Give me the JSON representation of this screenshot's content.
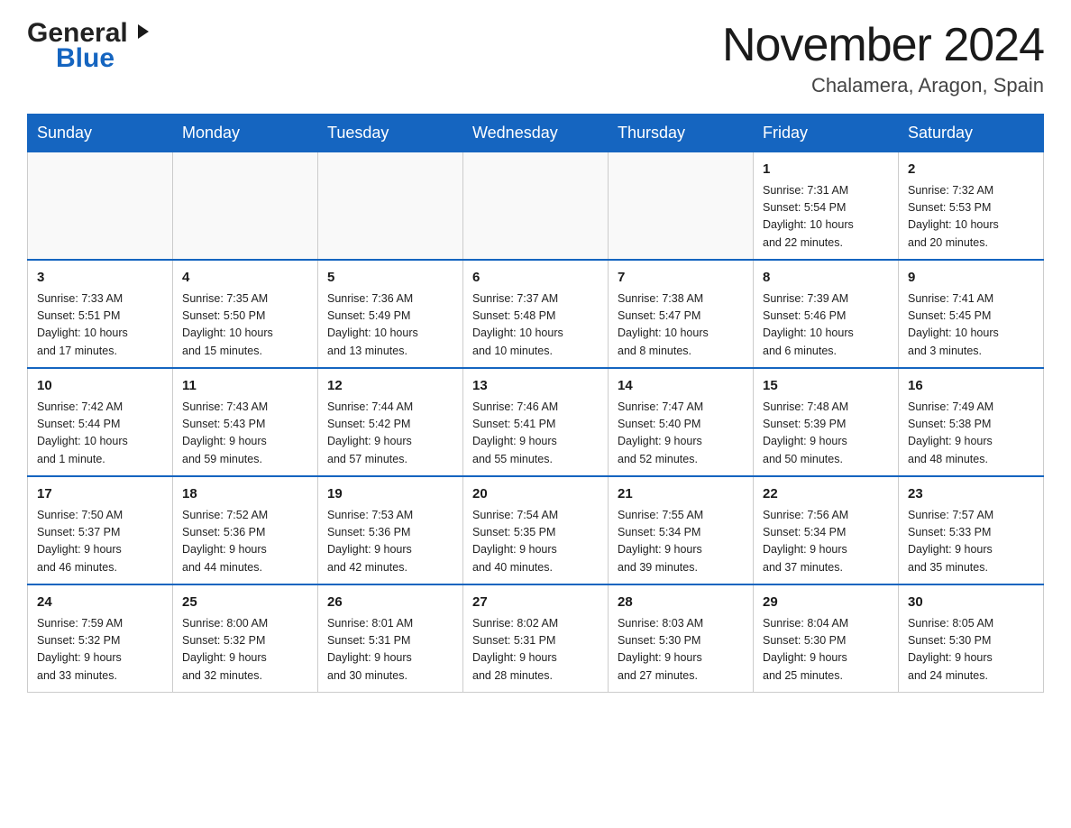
{
  "header": {
    "month_title": "November 2024",
    "location": "Chalamera, Aragon, Spain",
    "logo_general": "General",
    "logo_blue": "Blue"
  },
  "days_of_week": [
    "Sunday",
    "Monday",
    "Tuesday",
    "Wednesday",
    "Thursday",
    "Friday",
    "Saturday"
  ],
  "weeks": [
    [
      {
        "day": "",
        "info": ""
      },
      {
        "day": "",
        "info": ""
      },
      {
        "day": "",
        "info": ""
      },
      {
        "day": "",
        "info": ""
      },
      {
        "day": "",
        "info": ""
      },
      {
        "day": "1",
        "info": "Sunrise: 7:31 AM\nSunset: 5:54 PM\nDaylight: 10 hours\nand 22 minutes."
      },
      {
        "day": "2",
        "info": "Sunrise: 7:32 AM\nSunset: 5:53 PM\nDaylight: 10 hours\nand 20 minutes."
      }
    ],
    [
      {
        "day": "3",
        "info": "Sunrise: 7:33 AM\nSunset: 5:51 PM\nDaylight: 10 hours\nand 17 minutes."
      },
      {
        "day": "4",
        "info": "Sunrise: 7:35 AM\nSunset: 5:50 PM\nDaylight: 10 hours\nand 15 minutes."
      },
      {
        "day": "5",
        "info": "Sunrise: 7:36 AM\nSunset: 5:49 PM\nDaylight: 10 hours\nand 13 minutes."
      },
      {
        "day": "6",
        "info": "Sunrise: 7:37 AM\nSunset: 5:48 PM\nDaylight: 10 hours\nand 10 minutes."
      },
      {
        "day": "7",
        "info": "Sunrise: 7:38 AM\nSunset: 5:47 PM\nDaylight: 10 hours\nand 8 minutes."
      },
      {
        "day": "8",
        "info": "Sunrise: 7:39 AM\nSunset: 5:46 PM\nDaylight: 10 hours\nand 6 minutes."
      },
      {
        "day": "9",
        "info": "Sunrise: 7:41 AM\nSunset: 5:45 PM\nDaylight: 10 hours\nand 3 minutes."
      }
    ],
    [
      {
        "day": "10",
        "info": "Sunrise: 7:42 AM\nSunset: 5:44 PM\nDaylight: 10 hours\nand 1 minute."
      },
      {
        "day": "11",
        "info": "Sunrise: 7:43 AM\nSunset: 5:43 PM\nDaylight: 9 hours\nand 59 minutes."
      },
      {
        "day": "12",
        "info": "Sunrise: 7:44 AM\nSunset: 5:42 PM\nDaylight: 9 hours\nand 57 minutes."
      },
      {
        "day": "13",
        "info": "Sunrise: 7:46 AM\nSunset: 5:41 PM\nDaylight: 9 hours\nand 55 minutes."
      },
      {
        "day": "14",
        "info": "Sunrise: 7:47 AM\nSunset: 5:40 PM\nDaylight: 9 hours\nand 52 minutes."
      },
      {
        "day": "15",
        "info": "Sunrise: 7:48 AM\nSunset: 5:39 PM\nDaylight: 9 hours\nand 50 minutes."
      },
      {
        "day": "16",
        "info": "Sunrise: 7:49 AM\nSunset: 5:38 PM\nDaylight: 9 hours\nand 48 minutes."
      }
    ],
    [
      {
        "day": "17",
        "info": "Sunrise: 7:50 AM\nSunset: 5:37 PM\nDaylight: 9 hours\nand 46 minutes."
      },
      {
        "day": "18",
        "info": "Sunrise: 7:52 AM\nSunset: 5:36 PM\nDaylight: 9 hours\nand 44 minutes."
      },
      {
        "day": "19",
        "info": "Sunrise: 7:53 AM\nSunset: 5:36 PM\nDaylight: 9 hours\nand 42 minutes."
      },
      {
        "day": "20",
        "info": "Sunrise: 7:54 AM\nSunset: 5:35 PM\nDaylight: 9 hours\nand 40 minutes."
      },
      {
        "day": "21",
        "info": "Sunrise: 7:55 AM\nSunset: 5:34 PM\nDaylight: 9 hours\nand 39 minutes."
      },
      {
        "day": "22",
        "info": "Sunrise: 7:56 AM\nSunset: 5:34 PM\nDaylight: 9 hours\nand 37 minutes."
      },
      {
        "day": "23",
        "info": "Sunrise: 7:57 AM\nSunset: 5:33 PM\nDaylight: 9 hours\nand 35 minutes."
      }
    ],
    [
      {
        "day": "24",
        "info": "Sunrise: 7:59 AM\nSunset: 5:32 PM\nDaylight: 9 hours\nand 33 minutes."
      },
      {
        "day": "25",
        "info": "Sunrise: 8:00 AM\nSunset: 5:32 PM\nDaylight: 9 hours\nand 32 minutes."
      },
      {
        "day": "26",
        "info": "Sunrise: 8:01 AM\nSunset: 5:31 PM\nDaylight: 9 hours\nand 30 minutes."
      },
      {
        "day": "27",
        "info": "Sunrise: 8:02 AM\nSunset: 5:31 PM\nDaylight: 9 hours\nand 28 minutes."
      },
      {
        "day": "28",
        "info": "Sunrise: 8:03 AM\nSunset: 5:30 PM\nDaylight: 9 hours\nand 27 minutes."
      },
      {
        "day": "29",
        "info": "Sunrise: 8:04 AM\nSunset: 5:30 PM\nDaylight: 9 hours\nand 25 minutes."
      },
      {
        "day": "30",
        "info": "Sunrise: 8:05 AM\nSunset: 5:30 PM\nDaylight: 9 hours\nand 24 minutes."
      }
    ]
  ]
}
